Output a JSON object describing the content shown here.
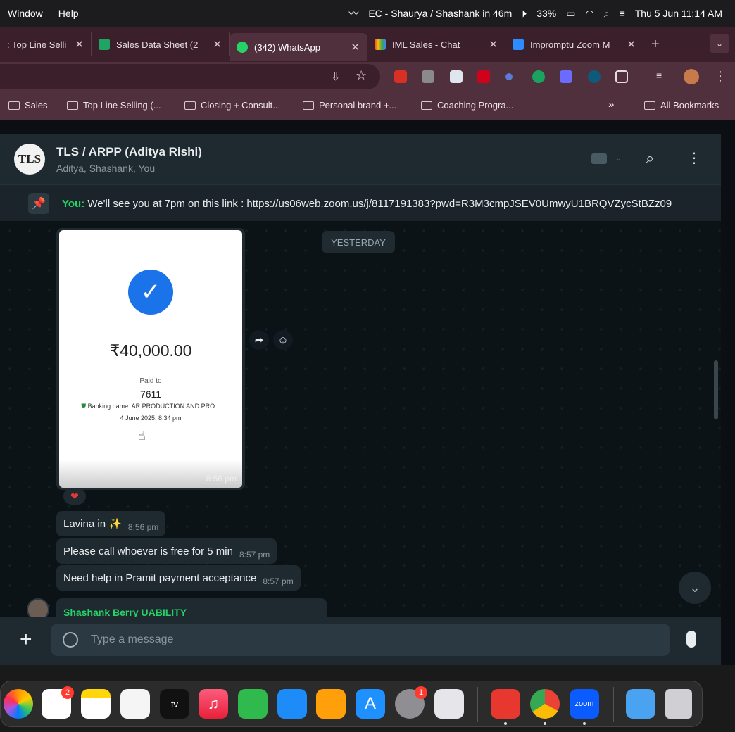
{
  "menubar": {
    "items": [
      "Window",
      "Help"
    ],
    "event": "EC - Shaurya / Shashank in 46m",
    "battery": "33%",
    "datetime": "Thu 5 Jun  11:14 AM"
  },
  "tabs": [
    {
      "label": ": Top Line Selli",
      "active": false
    },
    {
      "label": "Sales Data Sheet (2",
      "active": false
    },
    {
      "label": "(342) WhatsApp",
      "active": true
    },
    {
      "label": "IML Sales - Chat",
      "active": false
    },
    {
      "label": "Impromptu Zoom M",
      "active": false
    }
  ],
  "new_tab_label": "+",
  "bookmarks": [
    "Sales",
    "Top Line Selling (...",
    "Closing + Consult...",
    "Personal brand +...",
    "Coaching Progra..."
  ],
  "bookmarks_overflow": "»",
  "all_bookmarks": "All Bookmarks",
  "chat": {
    "avatar_text": "TLS",
    "title": "TLS / ARPP (Aditya Rishi)",
    "subtitle": "Aditya, Shashank, You",
    "pinned": {
      "sender": "You:",
      "text": "We'll see you at 7pm on this link :  https://us06web.zoom.us/j/8117191383?pwd=R3M3cmpJSEV0UmwyU1BRQVZycStBZz09"
    },
    "day_label": "YESTERDAY",
    "receipt": {
      "amount": "₹40,000.00",
      "paid_to_label": "Paid to",
      "payee": "7611",
      "bank": "Banking name: AR PRODUCTION AND PRO...",
      "date": "4 June 2025, 8:34 pm",
      "time": "8:56 pm"
    },
    "messages": [
      {
        "text": "Lavina in ✨",
        "time": "8:56 pm"
      },
      {
        "text": "Please call whoever is free for 5 min",
        "time": "8:57 pm"
      },
      {
        "text": "Need help in Pramit payment acceptance",
        "time": "8:57 pm"
      }
    ],
    "incoming_sender": "Shashank Berry UABILITY",
    "composer_placeholder": "Type a message"
  },
  "dock": {
    "reminders_badge": "2",
    "settings_badge": "1",
    "zoom_label": "zoom",
    "tv_label": "tv"
  },
  "colors": {
    "whatsapp_green": "#25d366",
    "browser_frame": "#3b1f2b",
    "chat_bg": "#0c1317"
  }
}
